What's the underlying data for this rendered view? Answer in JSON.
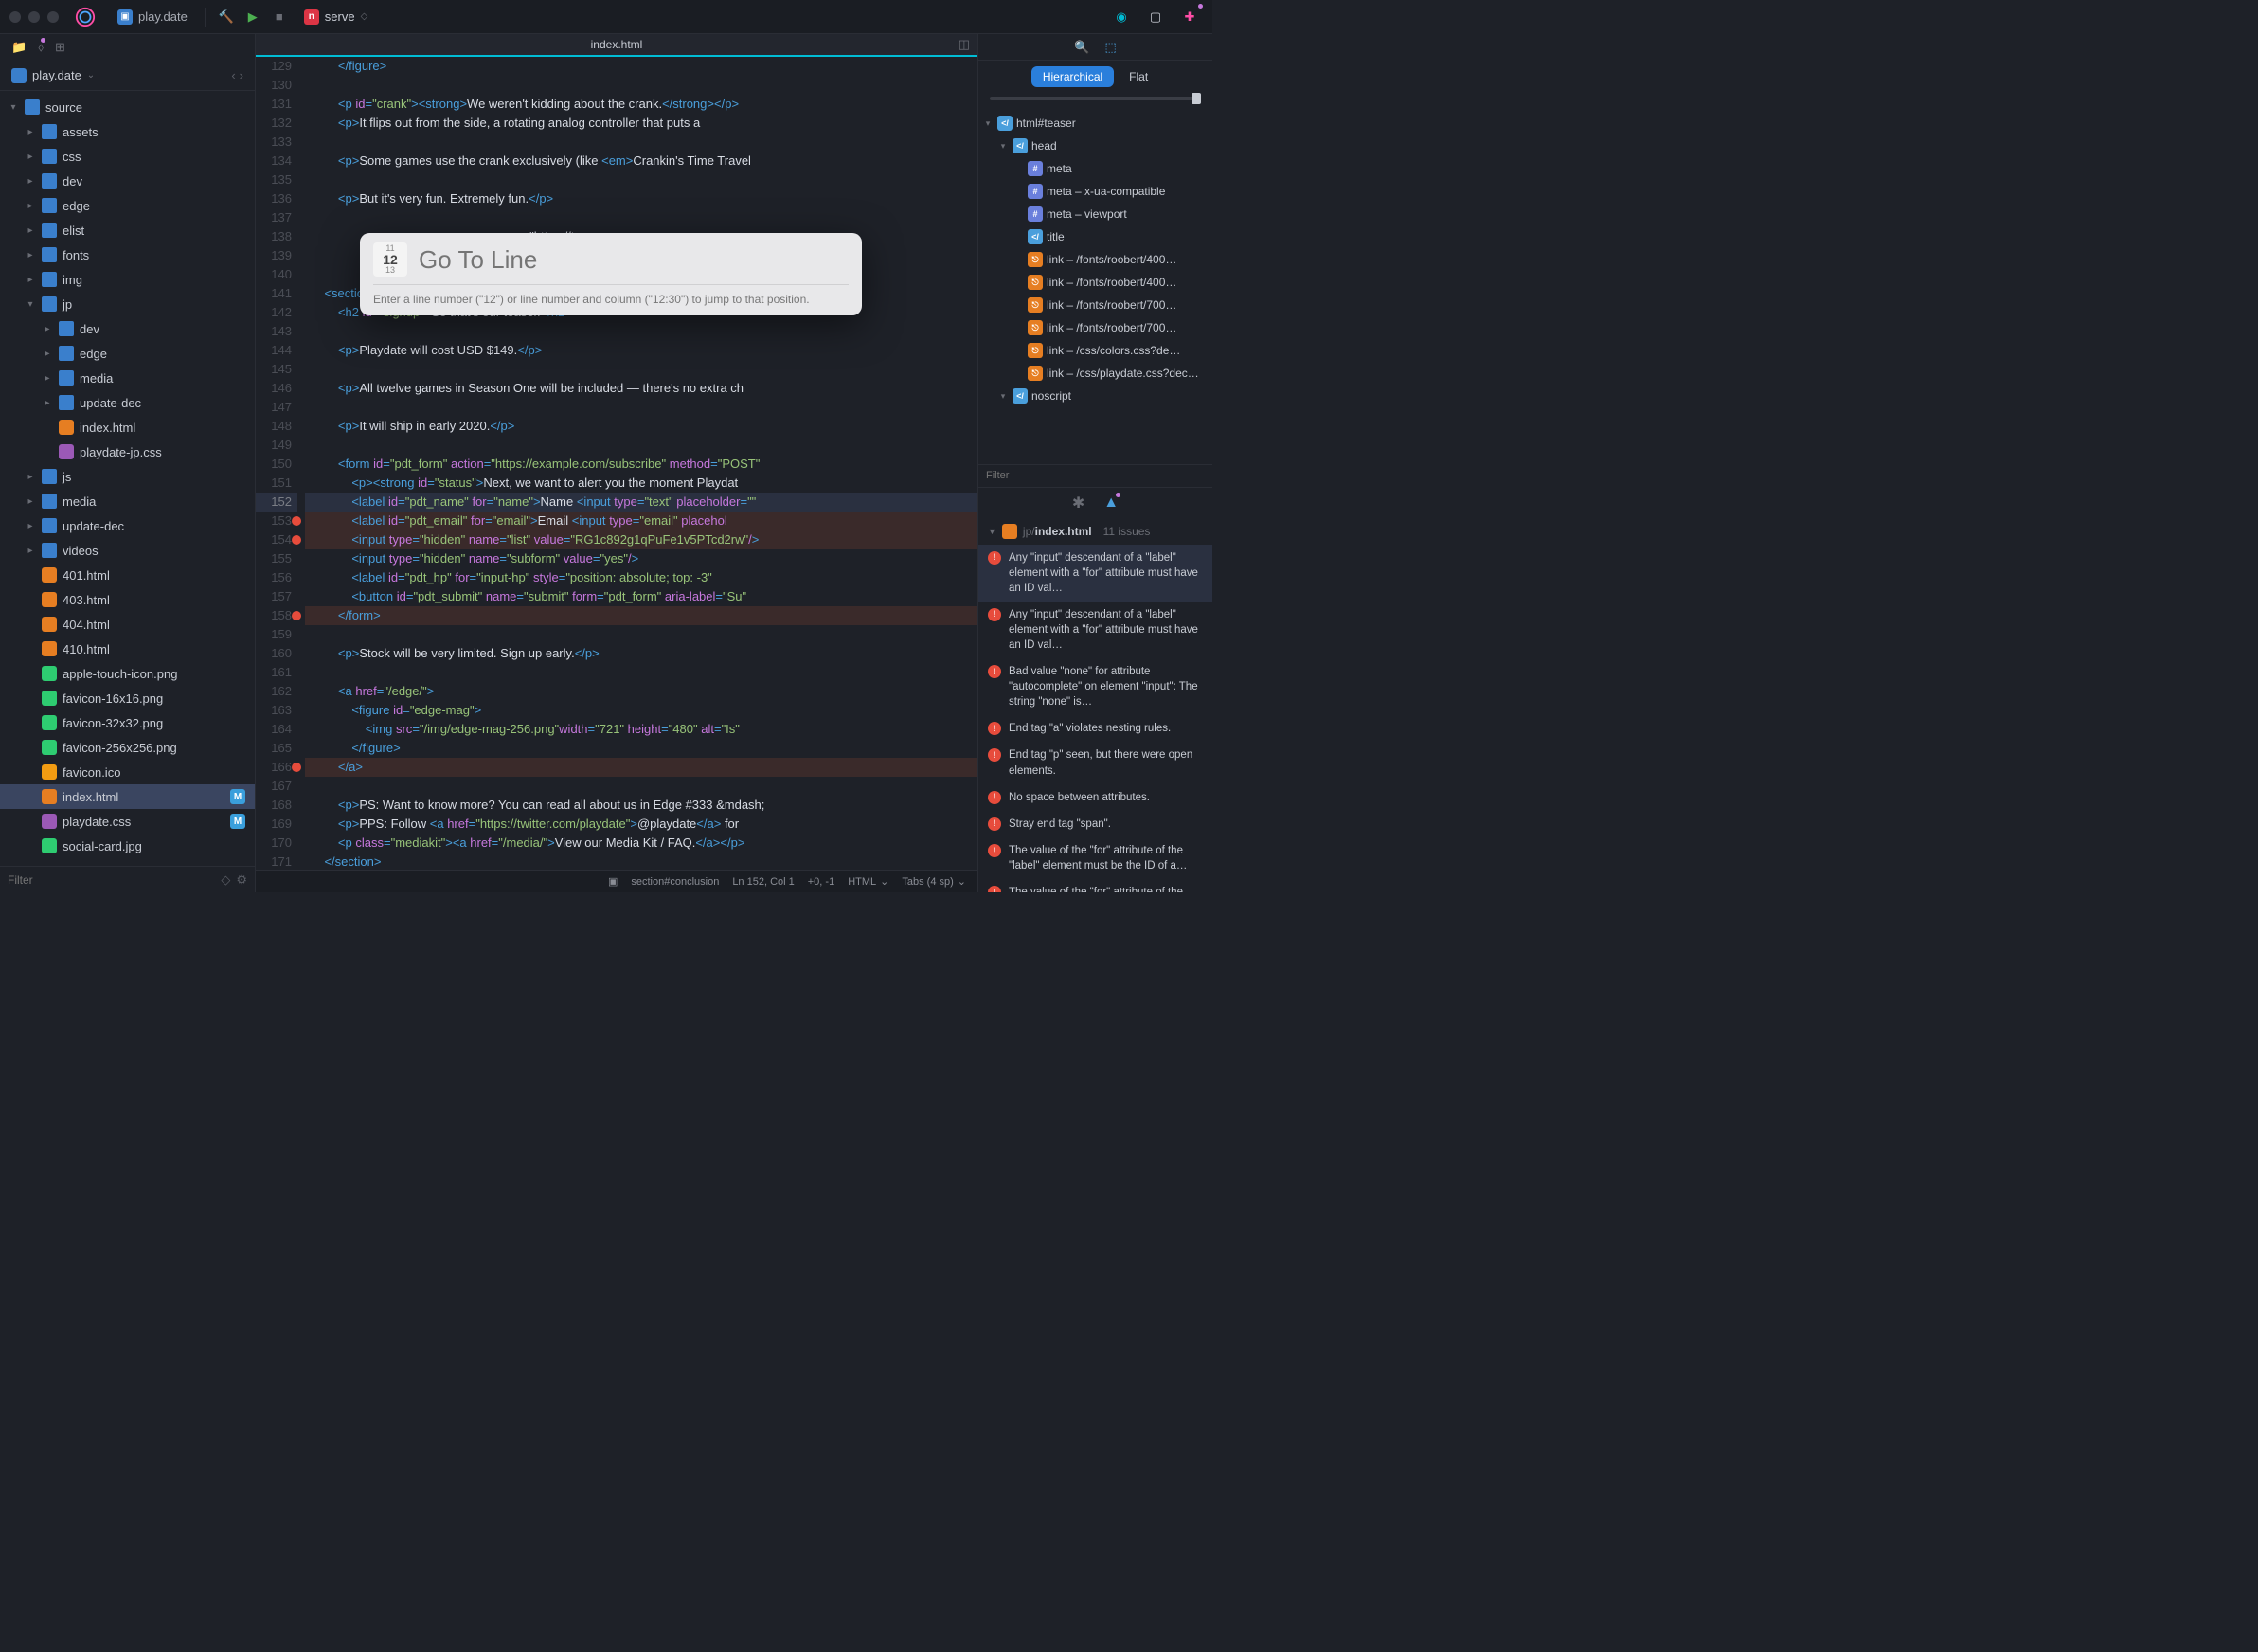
{
  "toolbar": {
    "project_tab": "play.date",
    "run_config": "serve",
    "run_arrows": "◇"
  },
  "project_bar": {
    "name": "play.date"
  },
  "nav_arrows": {
    "back": "‹",
    "fwd": "›"
  },
  "file_tree": [
    {
      "depth": 0,
      "type": "folder",
      "open": true,
      "label": "source"
    },
    {
      "depth": 1,
      "type": "folder",
      "open": false,
      "label": "assets"
    },
    {
      "depth": 1,
      "type": "folder",
      "open": false,
      "label": "css"
    },
    {
      "depth": 1,
      "type": "folder",
      "open": false,
      "label": "dev"
    },
    {
      "depth": 1,
      "type": "folder",
      "open": false,
      "label": "edge"
    },
    {
      "depth": 1,
      "type": "folder",
      "open": false,
      "label": "elist"
    },
    {
      "depth": 1,
      "type": "folder",
      "open": false,
      "label": "fonts"
    },
    {
      "depth": 1,
      "type": "folder",
      "open": false,
      "label": "img"
    },
    {
      "depth": 1,
      "type": "folder",
      "open": true,
      "label": "jp"
    },
    {
      "depth": 2,
      "type": "folder",
      "open": false,
      "label": "dev"
    },
    {
      "depth": 2,
      "type": "folder",
      "open": false,
      "label": "edge"
    },
    {
      "depth": 2,
      "type": "folder",
      "open": false,
      "label": "media"
    },
    {
      "depth": 2,
      "type": "folder",
      "open": false,
      "label": "update-dec"
    },
    {
      "depth": 2,
      "type": "file",
      "icon": "html",
      "label": "index.html"
    },
    {
      "depth": 2,
      "type": "file",
      "icon": "css",
      "label": "playdate-jp.css"
    },
    {
      "depth": 1,
      "type": "folder",
      "open": false,
      "label": "js"
    },
    {
      "depth": 1,
      "type": "folder",
      "open": false,
      "label": "media"
    },
    {
      "depth": 1,
      "type": "folder",
      "open": false,
      "label": "update-dec"
    },
    {
      "depth": 1,
      "type": "folder",
      "open": false,
      "label": "videos"
    },
    {
      "depth": 1,
      "type": "file",
      "icon": "html",
      "label": "401.html"
    },
    {
      "depth": 1,
      "type": "file",
      "icon": "html",
      "label": "403.html"
    },
    {
      "depth": 1,
      "type": "file",
      "icon": "html",
      "label": "404.html"
    },
    {
      "depth": 1,
      "type": "file",
      "icon": "html",
      "label": "410.html"
    },
    {
      "depth": 1,
      "type": "file",
      "icon": "img",
      "label": "apple-touch-icon.png"
    },
    {
      "depth": 1,
      "type": "file",
      "icon": "img",
      "label": "favicon-16x16.png"
    },
    {
      "depth": 1,
      "type": "file",
      "icon": "img",
      "label": "favicon-32x32.png"
    },
    {
      "depth": 1,
      "type": "file",
      "icon": "img",
      "label": "favicon-256x256.png"
    },
    {
      "depth": 1,
      "type": "file",
      "icon": "ico",
      "label": "favicon.ico"
    },
    {
      "depth": 1,
      "type": "file",
      "icon": "html",
      "label": "index.html",
      "selected": true,
      "badge": "M"
    },
    {
      "depth": 1,
      "type": "file",
      "icon": "css",
      "label": "playdate.css",
      "badge": "M"
    },
    {
      "depth": 1,
      "type": "file",
      "icon": "img",
      "label": "social-card.jpg"
    }
  ],
  "filter": {
    "placeholder": "Filter"
  },
  "editor": {
    "filename": "index.html",
    "first_line": 129,
    "highlighted_line": 152,
    "error_lines": [
      153,
      154,
      158,
      166
    ],
    "lines": [
      "        </figure>",
      "",
      "        <p id=\"crank\"><strong>We weren't kidding about the crank.</strong></p>",
      "        <p>It flips out from the side, a rotating analog controller that puts a ",
      "",
      "        <p>Some games use the crank exclusively (like <em>Crankin's Time Travel ",
      "",
      "        <p>But it's very fun. Extremely fun.</p>",
      "",
      "                                                                \"https://teena",
      "",
      "",
      "    <section id=\"conclusion\">",
      "        <h2 id=\"signup\">So that's our teaser.</h2>",
      "",
      "        <p>Playdate will cost USD $149.</p>",
      "",
      "        <p>All twelve games in Season One will be included — there's no extra ch",
      "",
      "        <p>It will ship in early 2020.</p>",
      "",
      "        <form id=\"pdt_form\" action=\"https://example.com/subscribe\" method=\"POST\"",
      "            <p><strong id=\"status\">Next, we want to alert you the moment Playdat",
      "            <label id=\"pdt_name\" for=\"name\">Name <input type=\"text\" placeholder=\"",
      "            <label id=\"pdt_email\" for=\"email\">Email <input type=\"email\" placehol",
      "            <input type=\"hidden\" name=\"list\" value=\"RG1c892g1qPuFe1v5PTcd2rw\"/>",
      "            <input type=\"hidden\" name=\"subform\" value=\"yes\"/>",
      "            <label id=\"pdt_hp\" for=\"input-hp\" style=\"position: absolute; top: -3",
      "            <button id=\"pdt_submit\" name=\"submit\" form=\"pdt_form\" aria-label=\"Su",
      "        </form>",
      "",
      "        <p>Stock will be very limited. Sign up early.</p>",
      "",
      "        <a href=\"/edge/\">",
      "            <figure id=\"edge-mag\">",
      "                <img src=\"/img/edge-mag-256.png\"width=\"721\" height=\"480\" alt=\"Is",
      "            </figure>",
      "        </a>",
      "",
      "        <p>PS: Want to know more? You can read all about us in Edge #333 &mdash;",
      "        <p>PPS: Follow <a href=\"https://twitter.com/playdate\">@playdate</a> for ",
      "        <p class=\"mediakit\"><a href=\"/media/\">View our Media Kit / FAQ.</a></p>",
      "    </section>"
    ]
  },
  "status": {
    "path": "section#conclusion",
    "pos": "Ln 152, Col 1",
    "delta": "+0, -1",
    "lang": "HTML",
    "indent": "Tabs (4 sp)"
  },
  "goto": {
    "icon_top": "11",
    "icon_mid": "12",
    "icon_bot": "13",
    "placeholder": "Go To Line",
    "hint": "Enter a line number (\"12\") or line number and column (\"12:30\") to jump to that position."
  },
  "inspector": {
    "view_hierarchical": "Hierarchical",
    "view_flat": "Flat",
    "dom": [
      {
        "depth": 0,
        "chev": "v",
        "icon": "el",
        "label": "html#teaser"
      },
      {
        "depth": 1,
        "chev": "v",
        "icon": "el",
        "label": "head"
      },
      {
        "depth": 2,
        "chev": "",
        "icon": "attr",
        "label": "meta"
      },
      {
        "depth": 2,
        "chev": "",
        "icon": "attr",
        "label": "meta – x-ua-compatible"
      },
      {
        "depth": 2,
        "chev": "",
        "icon": "attr",
        "label": "meta – viewport"
      },
      {
        "depth": 2,
        "chev": "",
        "icon": "el",
        "label": "title"
      },
      {
        "depth": 2,
        "chev": "",
        "icon": "link",
        "label": "link – /fonts/roobert/400…"
      },
      {
        "depth": 2,
        "chev": "",
        "icon": "link",
        "label": "link – /fonts/roobert/400…"
      },
      {
        "depth": 2,
        "chev": "",
        "icon": "link",
        "label": "link – /fonts/roobert/700…"
      },
      {
        "depth": 2,
        "chev": "",
        "icon": "link",
        "label": "link – /fonts/roobert/700…"
      },
      {
        "depth": 2,
        "chev": "",
        "icon": "link",
        "label": "link – /css/colors.css?de…"
      },
      {
        "depth": 2,
        "chev": "",
        "icon": "link",
        "label": "link – /css/playdate.css?dec…"
      },
      {
        "depth": 1,
        "chev": "v",
        "icon": "el",
        "label": "noscript"
      }
    ],
    "dom_filter": "Filter"
  },
  "issues": {
    "path_prefix": "jp/",
    "path_name": "index.html",
    "count": "11 issues",
    "items": [
      "Any \"input\" descendant of a \"label\" element with a \"for\" attribute must have an ID val…",
      "Any \"input\" descendant of a \"label\" element with a \"for\" attribute must have an ID val…",
      "Bad value \"none\" for attribute \"autocomplete\" on element \"input\": The string \"none\" is…",
      "End tag \"a\" violates nesting rules.",
      "End tag \"p\" seen, but there were open elements.",
      "No space between attributes.",
      "Stray end tag \"span\".",
      "The value of the \"for\" attribute of the \"label\" element must be the ID of a…",
      "The value of the \"for\" attribute of the \"label\""
    ]
  }
}
